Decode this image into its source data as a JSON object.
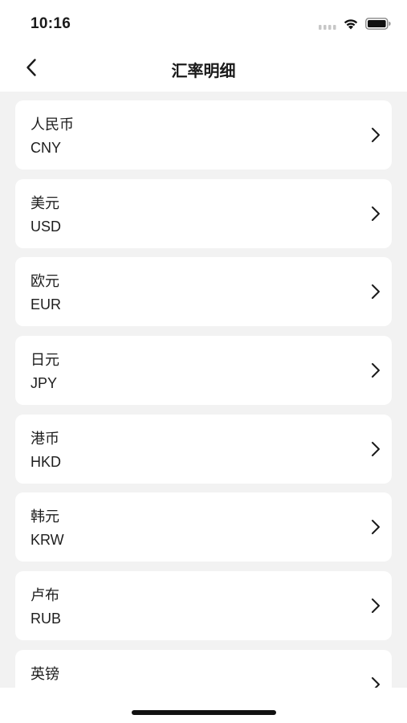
{
  "status_bar": {
    "time": "10:16"
  },
  "header": {
    "title": "汇率明细"
  },
  "currencies": [
    {
      "name": "人民币",
      "code": "CNY"
    },
    {
      "name": "美元",
      "code": "USD"
    },
    {
      "name": "欧元",
      "code": "EUR"
    },
    {
      "name": "日元",
      "code": "JPY"
    },
    {
      "name": "港币",
      "code": "HKD"
    },
    {
      "name": "韩元",
      "code": "KRW"
    },
    {
      "name": "卢布",
      "code": "RUB"
    },
    {
      "name": "英镑",
      "code": ""
    }
  ],
  "icons": {
    "back": "chevron-left-icon",
    "row_arrow": "chevron-right-icon",
    "signal": "cellular-signal-icon",
    "wifi": "wifi-icon",
    "battery": "battery-icon"
  },
  "colors": {
    "background": "#f2f2f2",
    "card": "#ffffff",
    "text": "#1e1e1e"
  }
}
